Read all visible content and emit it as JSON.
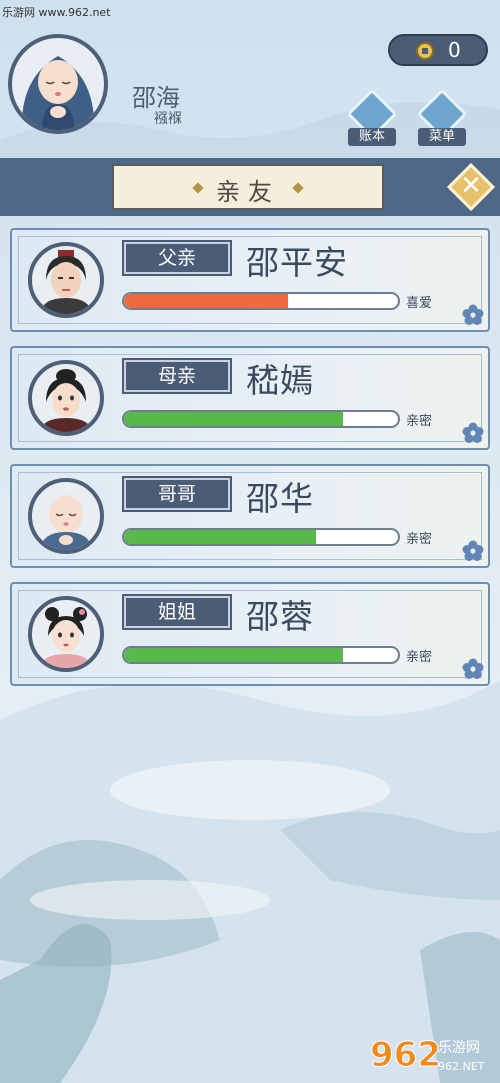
{
  "watermark": {
    "top_text": "乐游网 www.962.net",
    "bottom_logo_text": "962",
    "bottom_caption": "乐游网",
    "bottom_url": "962.NET"
  },
  "player": {
    "name": "邵海",
    "status": "襁褓"
  },
  "currency": {
    "icon": "coin-icon",
    "count": "0"
  },
  "menu_buttons": [
    {
      "label": "账本",
      "icon": "ledger-icon"
    },
    {
      "label": "菜单",
      "icon": "more-dots-icon"
    }
  ],
  "title": "亲友",
  "close_icon": "close-icon",
  "relatives": [
    {
      "relation": "父亲",
      "name": "邵平安",
      "affection": 0.6,
      "status": "喜爱",
      "bar_color": "#ee6a3e"
    },
    {
      "relation": "母亲",
      "name": "嵇嫣",
      "affection": 0.8,
      "status": "亲密",
      "bar_color": "#58b84a"
    },
    {
      "relation": "哥哥",
      "name": "邵华",
      "affection": 0.7,
      "status": "亲密",
      "bar_color": "#58b84a"
    },
    {
      "relation": "姐姐",
      "name": "邵蓉",
      "affection": 0.8,
      "status": "亲密",
      "bar_color": "#58b84a"
    }
  ]
}
